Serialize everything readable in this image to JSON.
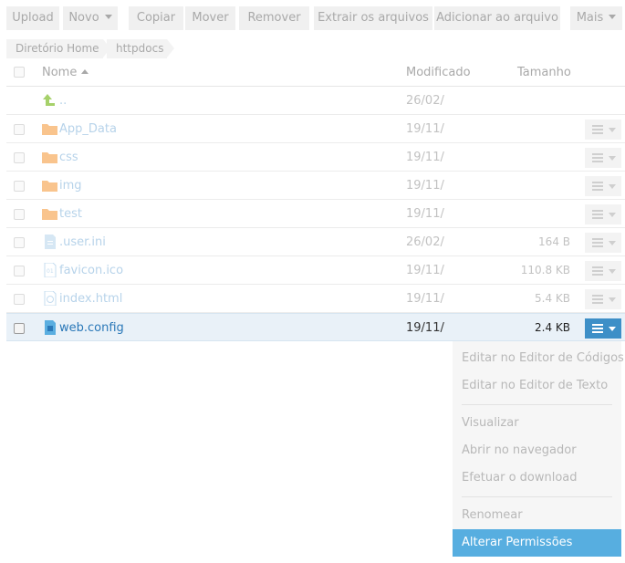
{
  "toolbar": {
    "upload": "Upload",
    "novo": "Novo",
    "copiar": "Copiar",
    "mover": "Mover",
    "remover": "Remover",
    "extrair": "Extrair os arquivos",
    "adicionar": "Adicionar ao arquivo",
    "mais": "Mais"
  },
  "breadcrumb": {
    "home": "Diretório Home",
    "current": "httpdocs"
  },
  "table": {
    "headers": {
      "name": "Nome",
      "modified": "Modificado",
      "size": "Tamanho"
    },
    "rows": [
      {
        "name": "..",
        "modified": "26/02/",
        "size": ""
      },
      {
        "name": "App_Data",
        "modified": "19/11/",
        "size": ""
      },
      {
        "name": "css",
        "modified": "19/11/",
        "size": ""
      },
      {
        "name": "img",
        "modified": "19/11/",
        "size": ""
      },
      {
        "name": "test",
        "modified": "19/11/",
        "size": ""
      },
      {
        "name": ".user.ini",
        "modified": "26/02/",
        "size": "164 B"
      },
      {
        "name": "favicon.ico",
        "modified": "19/11/",
        "size": "110.8 KB"
      },
      {
        "name": "index.html",
        "modified": "19/11/",
        "size": "5.4 KB"
      },
      {
        "name": "web.config",
        "modified": "19/11/",
        "size": "2.4 KB"
      }
    ]
  },
  "menu": {
    "items": [
      "Editar no Editor de Códigos",
      "Editar no Editor de Texto",
      "Visualizar",
      "Abrir no navegador",
      "Efetuar o download",
      "Renomear",
      "Alterar Permissões"
    ]
  },
  "colors": {
    "accent": "#3d8fc7",
    "menu_active": "#57aee0",
    "folder": "#f9c48d",
    "up_arrow": "#a6d16a"
  }
}
